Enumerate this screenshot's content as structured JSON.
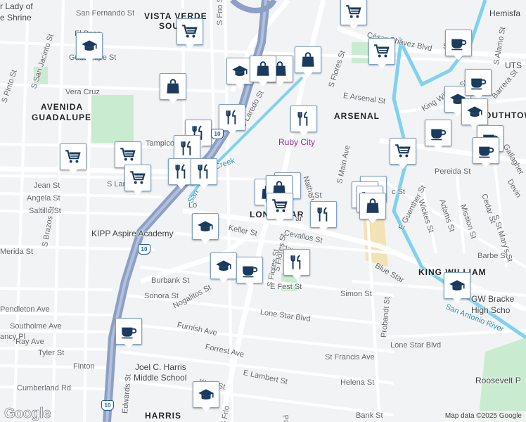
{
  "map": {
    "neighborhoods": [
      {
        "id": "vista-verde",
        "text": "VISTA VERDE"
      },
      {
        "id": "vista-verde-2",
        "text": "SOU"
      },
      {
        "id": "avenida",
        "text": "AVENIDA"
      },
      {
        "id": "guadalupe",
        "text": "GUADALUPE"
      },
      {
        "id": "arsenal",
        "text": "ARSENAL"
      },
      {
        "id": "lone-star",
        "text": "LONE STAR"
      },
      {
        "id": "king-william",
        "text": "KING WILLIAM"
      },
      {
        "id": "southtown",
        "text": "SOUTHTOWN"
      },
      {
        "id": "harris",
        "text": "HARRIS"
      }
    ],
    "places": [
      {
        "id": "lady-guadalupe",
        "text": "r Lady of",
        "cls": ""
      },
      {
        "id": "lady-guadalupe-2",
        "text": "e Shrine",
        "cls": ""
      },
      {
        "id": "ruby-city",
        "text": "Ruby City",
        "cls": "purple"
      },
      {
        "id": "kipp",
        "text": "KIPP Aspire Academy",
        "cls": ""
      },
      {
        "id": "jch-1",
        "text": "Joel C. Harris",
        "cls": ""
      },
      {
        "id": "jch-2",
        "text": "Middle School",
        "cls": ""
      },
      {
        "id": "gw-1",
        "text": "GW Bracke",
        "cls": ""
      },
      {
        "id": "gw-2",
        "text": "High Scho",
        "cls": ""
      },
      {
        "id": "roosevelt",
        "text": "Roosevelt P",
        "cls": ""
      },
      {
        "id": "hemisfair",
        "text": "Hemisfa",
        "cls": ""
      },
      {
        "id": "utsa",
        "text": "UTS",
        "cls": ""
      }
    ],
    "streets": [
      {
        "id": "san-fernando",
        "text": "San Fernando St"
      },
      {
        "id": "s-frio-top",
        "text": "S Frio St"
      },
      {
        "id": "el-paso",
        "text": "El Paso"
      },
      {
        "id": "guadalupe-st",
        "text": "Guadalupe St"
      },
      {
        "id": "vera-cruz",
        "text": "Vera Cruz"
      },
      {
        "id": "s-pinto",
        "text": "S Pinto St"
      },
      {
        "id": "s-san-jacinto",
        "text": "S San Jacinto St"
      },
      {
        "id": "tampico",
        "text": "Tampico"
      },
      {
        "id": "jean",
        "text": "Jean St"
      },
      {
        "id": "angela",
        "text": "Angela St"
      },
      {
        "id": "saltillo",
        "text": "Saltillo St"
      },
      {
        "id": "s-laredo-left",
        "text": "S Laredo St"
      },
      {
        "id": "s-laredo",
        "text": "S Laredo St"
      },
      {
        "id": "s-brazos",
        "text": "S Brazos St"
      },
      {
        "id": "keller",
        "text": "Keller St"
      },
      {
        "id": "cevallos",
        "text": "Cevallos St"
      },
      {
        "id": "merida",
        "text": "Merida St"
      },
      {
        "id": "burbank",
        "text": "Burbank St"
      },
      {
        "id": "nogalitos",
        "text": "Nogalitos St"
      },
      {
        "id": "sonora",
        "text": "Sonora St"
      },
      {
        "id": "s-flores-mid",
        "text": "S Flores St"
      },
      {
        "id": "clay",
        "text": "Clay"
      },
      {
        "id": "e-fest",
        "text": "E Fest St"
      },
      {
        "id": "simon",
        "text": "Simon St"
      },
      {
        "id": "pendleton",
        "text": "Pendleton Ave"
      },
      {
        "id": "southolme",
        "text": "Southolme Ave"
      },
      {
        "id": "ray",
        "text": "Ray Ave"
      },
      {
        "id": "nancy",
        "text": "ancy Pl"
      },
      {
        "id": "tyler",
        "text": "Tyler St"
      },
      {
        "id": "furnish",
        "text": "Furnish Ave"
      },
      {
        "id": "lone-star-blvd",
        "text": "Lone Star Blvd"
      },
      {
        "id": "lone-star-blvd-2",
        "text": "Lone Star Blvd"
      },
      {
        "id": "forrest",
        "text": "Forrest Ave"
      },
      {
        "id": "finton",
        "text": "Finton"
      },
      {
        "id": "edwards",
        "text": "Edwards St"
      },
      {
        "id": "klein",
        "text": "Klein St"
      },
      {
        "id": "e-lambert",
        "text": "E Lambert St"
      },
      {
        "id": "cumberland",
        "text": "Cumberland Rd"
      },
      {
        "id": "helena",
        "text": "Helena St"
      },
      {
        "id": "st-francis",
        "text": "St Francis Ave"
      },
      {
        "id": "bank",
        "text": "Bank St"
      },
      {
        "id": "s-frio-bottom",
        "text": "S Frio"
      },
      {
        "id": "probandt",
        "text": "Probandt St"
      },
      {
        "id": "blue-star",
        "text": "Blue Star"
      },
      {
        "id": "barbe",
        "text": "Barbe St"
      },
      {
        "id": "s-flores-top",
        "text": "S Flores St"
      },
      {
        "id": "e-arsenal",
        "text": "E Arsenal St"
      },
      {
        "id": "nathan",
        "text": "Nathan"
      },
      {
        "id": "s-main",
        "text": "S Main Ave"
      },
      {
        "id": "cesar",
        "text": "César Chávez Blvd"
      },
      {
        "id": "pereida",
        "text": "Pereida St"
      },
      {
        "id": "e-guenther",
        "text": "E Guenther St"
      },
      {
        "id": "wickes",
        "text": "Wickes St"
      },
      {
        "id": "adams",
        "text": "Adams St"
      },
      {
        "id": "mission",
        "text": "Mission St"
      },
      {
        "id": "cedar",
        "text": "Cedar St"
      },
      {
        "id": "king-william-st",
        "text": "King William St"
      },
      {
        "id": "s-alamo",
        "text": "S Alamo St"
      },
      {
        "id": "st-marys",
        "text": "S St Mary's St"
      },
      {
        "id": "barrera",
        "text": "Barrera St"
      },
      {
        "id": "devine",
        "text": "Devin"
      },
      {
        "id": "gallagher",
        "text": "Gallagher"
      },
      {
        "id": "san-saba",
        "text": "San"
      },
      {
        "id": "madison",
        "text": "Madis"
      },
      {
        "id": "s-flores-low",
        "text": "S Flores St"
      },
      {
        "id": "pa",
        "text": "Pa"
      },
      {
        "id": "lone-star-road",
        "text": "Lo"
      },
      {
        "id": "ar",
        "text": "ar"
      },
      {
        "id": "o-st",
        "text": "o St"
      },
      {
        "id": "c-st",
        "text": "c St"
      }
    ],
    "waterways": [
      {
        "id": "san-antonio-river",
        "text": "San Antonio River"
      },
      {
        "id": "san-pedro-creek",
        "text": "San"
      },
      {
        "id": "creek-2",
        "text": "Creek"
      }
    ],
    "highway_shield": "10",
    "markers": [
      {
        "id": "m1",
        "icon": "grocery"
      },
      {
        "id": "m2",
        "icon": "grocery"
      },
      {
        "id": "m3",
        "icon": "school"
      },
      {
        "id": "m4",
        "icon": "shopping"
      },
      {
        "id": "m5",
        "icon": "shopping"
      },
      {
        "id": "m6",
        "icon": "school"
      },
      {
        "id": "m7",
        "icon": "shopping"
      },
      {
        "id": "m8",
        "icon": "shopping"
      },
      {
        "id": "m9",
        "icon": "restaurant"
      },
      {
        "id": "m10",
        "icon": "restaurant"
      },
      {
        "id": "m11",
        "icon": "restaurant"
      },
      {
        "id": "m12",
        "icon": "restaurant"
      },
      {
        "id": "m13",
        "icon": "grocery"
      },
      {
        "id": "m14",
        "icon": "grocery"
      },
      {
        "id": "m15",
        "icon": "grocery"
      },
      {
        "id": "m16",
        "icon": "restaurant"
      },
      {
        "id": "m17",
        "icon": "restaurant"
      },
      {
        "id": "m18",
        "icon": "restaurant"
      },
      {
        "id": "m19",
        "icon": "school"
      },
      {
        "id": "m20",
        "icon": "shopping"
      },
      {
        "id": "m21",
        "icon": "shopping"
      },
      {
        "id": "m22",
        "icon": "grocery"
      },
      {
        "id": "m23",
        "icon": "restaurant"
      },
      {
        "id": "m24",
        "icon": "school"
      },
      {
        "id": "m25",
        "icon": "cafe"
      },
      {
        "id": "m26",
        "icon": "restaurant"
      },
      {
        "id": "m27",
        "icon": "grocery"
      },
      {
        "id": "m28",
        "icon": "grocery"
      },
      {
        "id": "m29",
        "icon": "shopping"
      },
      {
        "id": "m30",
        "icon": "grocery"
      },
      {
        "id": "m31",
        "icon": "cafe"
      },
      {
        "id": "m32",
        "icon": "cafe"
      },
      {
        "id": "m33",
        "icon": "school"
      },
      {
        "id": "m34",
        "icon": "cafe"
      },
      {
        "id": "m35",
        "icon": "school"
      },
      {
        "id": "m36",
        "icon": "cafe"
      },
      {
        "id": "m37",
        "icon": "cafe"
      },
      {
        "id": "m38",
        "icon": "school"
      },
      {
        "id": "m39",
        "icon": "cafe"
      },
      {
        "id": "m40",
        "icon": "school"
      },
      {
        "id": "m41",
        "icon": "grocery"
      },
      {
        "id": "m42",
        "icon": "shopping"
      }
    ],
    "brand": "Google",
    "attribution": "Map data ©2025 Google"
  },
  "colors": {
    "background": "#f1f3f4",
    "road": "#ffffff",
    "highway": "#8c9fc4",
    "water": "#7fd2ef",
    "park": "#c9ecd1",
    "marker_icon": "#1a3a5e"
  }
}
